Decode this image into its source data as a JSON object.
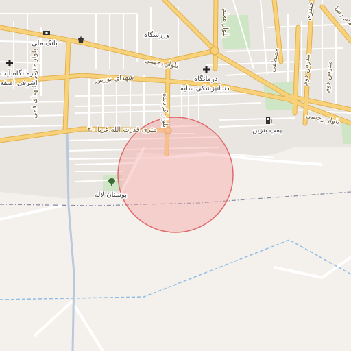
{
  "map": {
    "colors": {
      "background": "#f4f1ec",
      "urban": "#e9e6e1",
      "park": "#cfe6c6",
      "minor_road": "#ffffff",
      "major_road": "#f7d27a",
      "major_road_casing": "#e2b04f",
      "boundary": "#8a8fa8",
      "waterway": "#8fbde6",
      "search_area_fill": "#f7a6a6",
      "search_area_stroke": "#e06a6a"
    },
    "road_labels": {
      "blvd_rahimi_top": "بلوار رحیمی",
      "blvd_rahimi_right": "بلوار رحیمی",
      "shohada_boroujerd": "شهدای بوربور",
      "qodratollah": "۲۰ متری قدرت الله غربا",
      "blvd_kardideh": "بلوار کردیده",
      "blvd_shohada_south": "بلوار جنوبی شهدای قمی",
      "blvd_aval": "بلوار معلم",
      "imam_reza": "بلوار امام رضا",
      "mostafa": "مصطفی",
      "madares": "مدرس دوم",
      "abuzar": "مدرس دوم"
    },
    "poi_labels": {
      "bank_melli": "بانک ملی",
      "varzeshgah": "ورزشگاه",
      "dentistry": "درمانگاه",
      "dentistry_line2": "دندانپزشکی سایه",
      "clinic_left_line1": "درمانگاه آیت",
      "clinic_left_line2": "اشرفی اصفه",
      "gas_station": "پمپ بنزین",
      "park_laleh": "بوستان لاله",
      "heydari": "حیدری"
    },
    "icons": {
      "bank": "bank-icon",
      "shop": "shopping-icon",
      "hospital": "hospital-icon",
      "fuel": "fuel-icon",
      "park": "tree-icon"
    }
  }
}
